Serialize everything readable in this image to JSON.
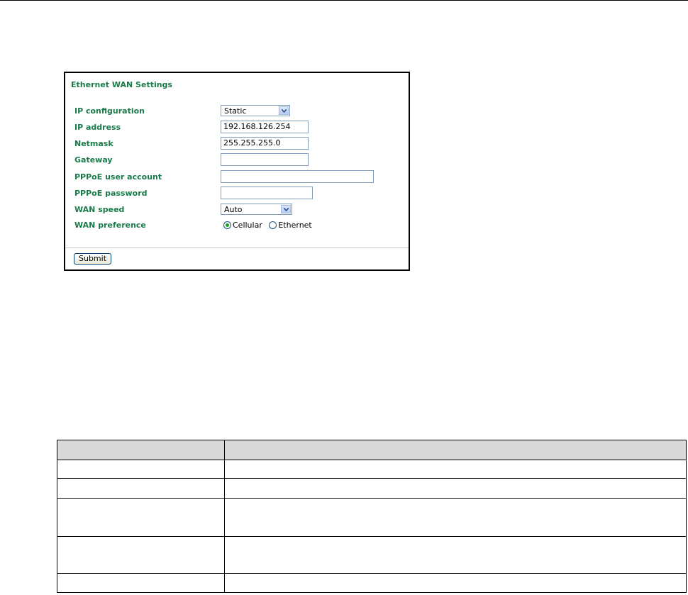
{
  "panel": {
    "title": "Ethernet WAN Settings",
    "fields": [
      {
        "label": "IP configuration",
        "type": "select",
        "value": "Static"
      },
      {
        "label": "IP address",
        "type": "text",
        "value": "192.168.126.254"
      },
      {
        "label": "Netmask",
        "type": "text",
        "value": "255.255.255.0"
      },
      {
        "label": "Gateway",
        "type": "text",
        "value": ""
      },
      {
        "label": "PPPoE user account",
        "type": "text",
        "value": ""
      },
      {
        "label": "PPPoE password",
        "type": "password",
        "value": ""
      },
      {
        "label": "WAN speed",
        "type": "select",
        "value": "Auto"
      },
      {
        "label": "WAN preference",
        "type": "radio",
        "options": [
          "Cellular",
          "Ethernet"
        ],
        "selected": "Cellular"
      }
    ],
    "submit_label": "Submit"
  },
  "colors": {
    "label_green": "#1a7a4a",
    "header_gray": "#d9d9d9"
  }
}
